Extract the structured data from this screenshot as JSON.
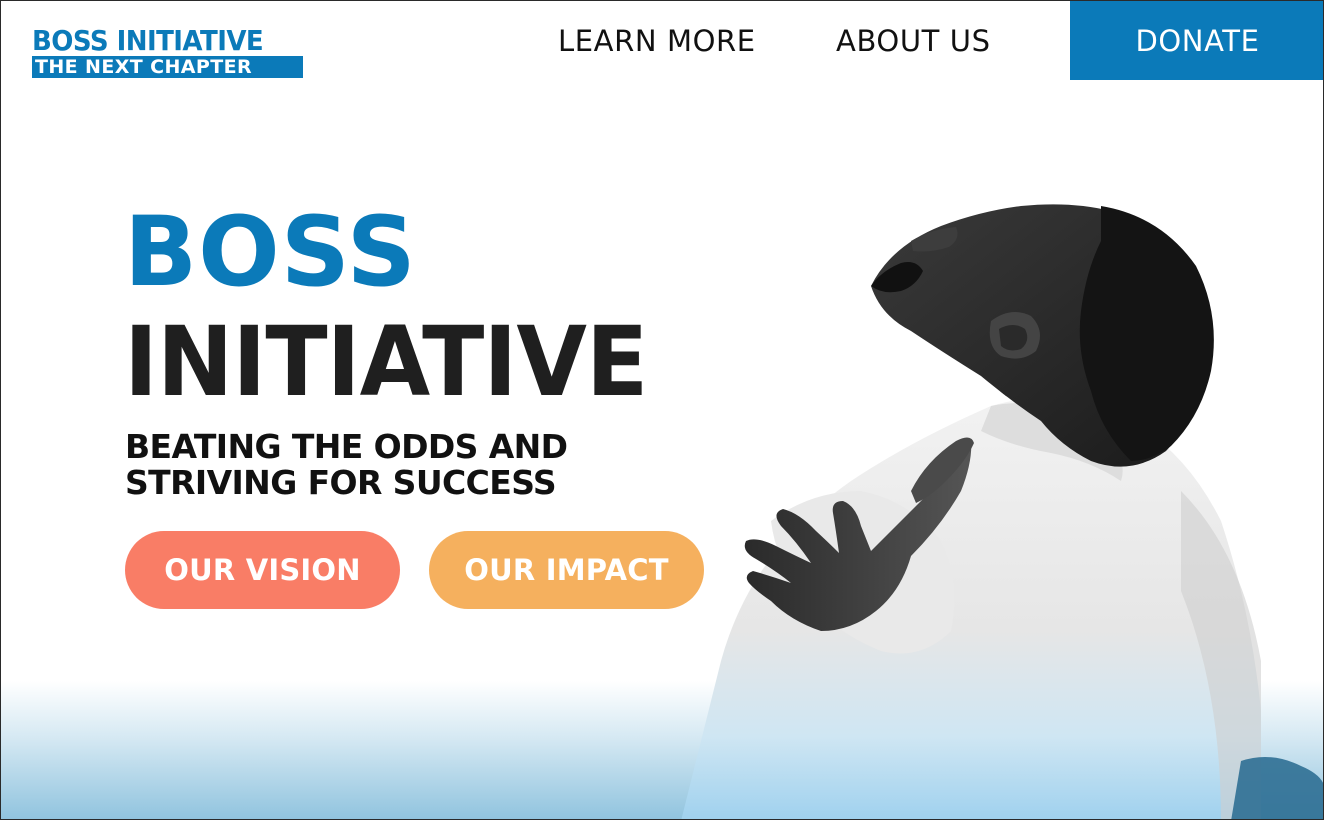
{
  "brand": {
    "logo_line1": "BOSS INITIATIVE",
    "logo_line2": "THE NEXT CHAPTER",
    "primary_color": "#0b7ab9"
  },
  "nav": {
    "learn_more": "LEARN MORE",
    "about_us": "ABOUT US",
    "donate": "DONATE"
  },
  "hero": {
    "title_line1": "BOSS",
    "title_line2": "INITIATIVE",
    "tagline_line1": "BEATING THE ODDS AND",
    "tagline_line2": "STRIVING FOR SUCCESS",
    "vision_button": "OUR VISION",
    "impact_button": "OUR IMPACT",
    "vision_color": "#f97d66",
    "impact_color": "#f5b05e"
  },
  "image": {
    "icon": "person-arms-outstretched-photo"
  }
}
